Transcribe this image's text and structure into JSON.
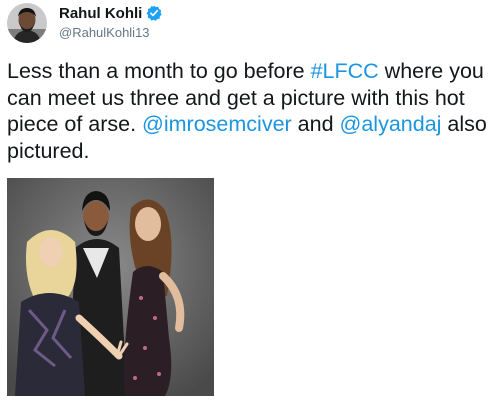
{
  "author": {
    "name": "Rahul Kohli",
    "handle": "@RahulKohli13",
    "verified": true,
    "avatar_icon": "profile-avatar-icon"
  },
  "tweet": {
    "text_1": "Less than a month to go before ",
    "hashtag": "#LFCC",
    "text_2": " where you can meet us three and get a picture with this hot piece of arse. ",
    "mention_1": "@imrosemciver",
    "text_3": " and ",
    "mention_2": "@alyandaj",
    "text_4": " also pictured."
  },
  "colors": {
    "text": "#14171a",
    "secondary": "#657786",
    "link": "#1b95e0",
    "verified_badge": "#1da1f2"
  }
}
